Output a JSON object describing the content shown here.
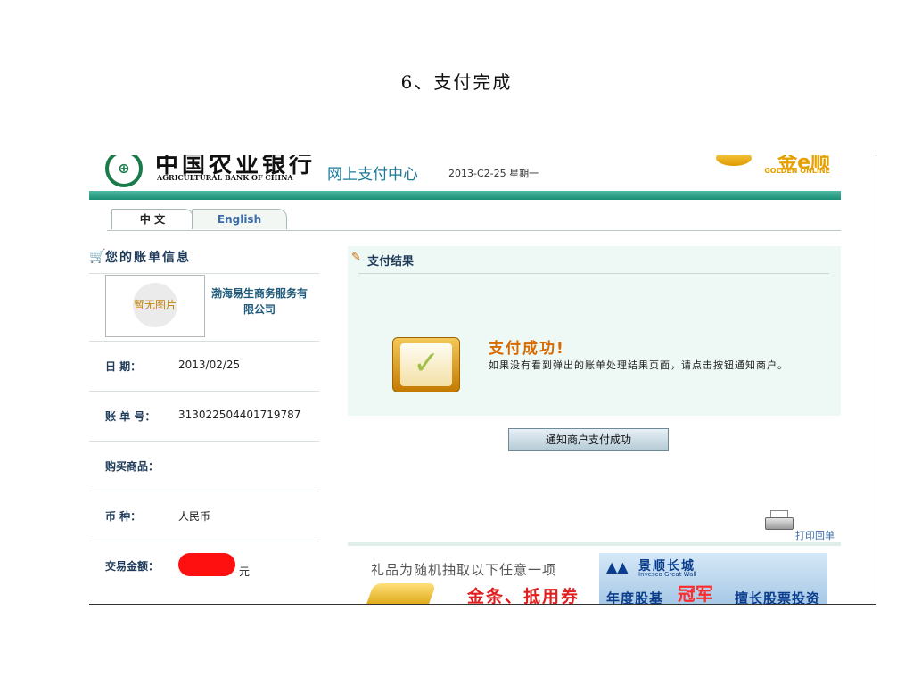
{
  "slide_title": "6、支付完成",
  "header": {
    "bank_name_cn": "中国农业银行",
    "bank_name_en": "AGRICULTURAL BANK OF CHINA",
    "center_title": "网上支付中心",
    "date": "2013-C2-25 星期一",
    "golden_cn": "金e顺",
    "golden_en": "GOLDEN ONLINE"
  },
  "tabs": [
    {
      "label": "中 文"
    },
    {
      "label": "English"
    }
  ],
  "bill": {
    "section_title": "您的账单信息",
    "image_placeholder": "暂无图片",
    "merchant": "渤海易生商务服务有限公司",
    "fields": [
      {
        "label": "日 期：",
        "value": "2013/02/25"
      },
      {
        "label": "账 单 号：",
        "value": "313022504401719787"
      },
      {
        "label": "购买商品：",
        "value": ""
      },
      {
        "label": "币 种：",
        "value": "人民币"
      },
      {
        "label": "交易金额：",
        "value": "元"
      }
    ]
  },
  "result": {
    "title": "支付结果",
    "success_heading": "支付成功!",
    "success_desc": "如果没有看到弹出的账单处理结果页面，请点击按钮通知商户。",
    "notify_button": "通知商户支付成功",
    "print_label": "打印回单"
  },
  "ads": {
    "ad1_text": "礼品为随机抽取以下任意一项",
    "ad1_highlight": "金条、抵用券",
    "ad2_brand_cn": "景顺长城",
    "ad2_brand_en": "Invesco Great Wall",
    "ad2_left": "年度股基",
    "ad2_badge": "冠军",
    "ad2_right": "擅长股票投资"
  }
}
